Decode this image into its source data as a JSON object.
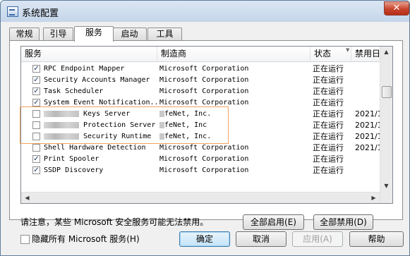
{
  "window": {
    "title": "系统配置",
    "close_label": "✕"
  },
  "tabs": [
    {
      "label": "常规"
    },
    {
      "label": "引导"
    },
    {
      "label": "服务"
    },
    {
      "label": "启动"
    },
    {
      "label": "工具"
    }
  ],
  "services": {
    "columns": [
      "服务",
      "制造商",
      "状态",
      "禁用日"
    ],
    "rows": [
      {
        "checked": true,
        "name": "RPC Endpoint Mapper",
        "vendor": "Microsoft Corporation",
        "status": "正在运行",
        "date": ""
      },
      {
        "checked": true,
        "name": "Security Accounts Manager",
        "vendor": "Microsoft Corporation",
        "status": "正在运行",
        "date": ""
      },
      {
        "checked": true,
        "name": "Task Scheduler",
        "vendor": "Microsoft Corporation",
        "status": "正在运行",
        "date": ""
      },
      {
        "checked": true,
        "name": "System Event Notification...",
        "vendor": "Microsoft Corporation",
        "status": "正在运行",
        "date": ""
      },
      {
        "checked": false,
        "name": "Keys Server",
        "vendor": "feNet, Inc.",
        "status": "正在运行",
        "date": "2021/1"
      },
      {
        "checked": false,
        "name": "Protection Server",
        "vendor": "feNet, Inc",
        "status": "正在运行",
        "date": "2021/1"
      },
      {
        "checked": false,
        "name": "Security Runtime",
        "vendor": "feNet, Inc.",
        "status": "正在运行",
        "date": "2021/1"
      },
      {
        "checked": false,
        "name": "Shell Hardware Detection",
        "vendor": "Microsoft Corporation",
        "status": "正在运行",
        "date": "2021/1"
      },
      {
        "checked": true,
        "name": "Print Spooler",
        "vendor": "Microsoft Corporation",
        "status": "正在运行",
        "date": ""
      },
      {
        "checked": true,
        "name": "SSDP Discovery",
        "vendor": "Microsoft Corporation",
        "status": "正在运行",
        "date": ""
      }
    ]
  },
  "note": "请注意，某些 Microsoft 安全服务可能无法禁用。",
  "buttons": {
    "enable_all": "全部启用(E)",
    "disable_all": "全部禁用(D)",
    "ok": "确定",
    "cancel": "取消",
    "apply": "应用(A)",
    "help": "帮助"
  },
  "hide_ms": {
    "label": "隐藏所有 Microsoft 服务(H)",
    "checked": false
  },
  "colors": {
    "highlight": "#f0a25e",
    "close": "#c7442b",
    "checkmark": "#1c3e6e"
  }
}
